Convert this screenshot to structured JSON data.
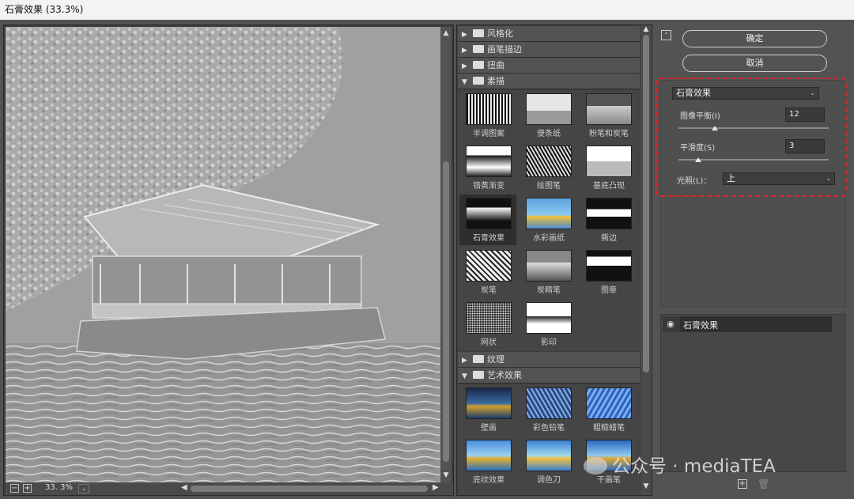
{
  "window": {
    "title": "石膏效果 (33.3%)"
  },
  "preview": {
    "zoom_out": "−",
    "zoom_in": "+",
    "zoom_level": "33. 3%",
    "zoom_dropdown": "⌄"
  },
  "gallery": {
    "folders": [
      {
        "label": "风格化",
        "expanded": false
      },
      {
        "label": "画笔描边",
        "expanded": false
      },
      {
        "label": "扭曲",
        "expanded": false
      },
      {
        "label": "素描",
        "expanded": true
      },
      {
        "label": "纹理",
        "expanded": false
      },
      {
        "label": "艺术效果",
        "expanded": true
      }
    ],
    "sketch_filters": [
      "半调图案",
      "便条纸",
      "粉笔和炭笔",
      "铬黄渐变",
      "绘图笔",
      "基底凸现",
      "石膏效果",
      "水彩画纸",
      "撕边",
      "炭笔",
      "炭精笔",
      "图章",
      "网状",
      "影印"
    ],
    "artistic_filters": [
      "壁画",
      "彩色铅笔",
      "粗糙蜡笔",
      "底纹效果",
      "调色刀",
      "干画笔"
    ],
    "selected_filter": "石膏效果"
  },
  "buttons": {
    "ok": "确定",
    "cancel": "取消"
  },
  "settings": {
    "filter_name": "石膏效果",
    "image_balance_label": "图像平衡(I)",
    "image_balance_value": "12",
    "image_balance_level": 0.24,
    "smoothness_label": "平滑度(S)",
    "smoothness_value": "3",
    "smoothness_level": 0.13,
    "light_label": "光照(L)：",
    "light_value": "上"
  },
  "layers": {
    "items": [
      "石膏效果"
    ]
  },
  "watermark": "公众号 · mediaTEA",
  "colors": {
    "highlight_box": "#d62828",
    "panel_bg": "#535353"
  }
}
